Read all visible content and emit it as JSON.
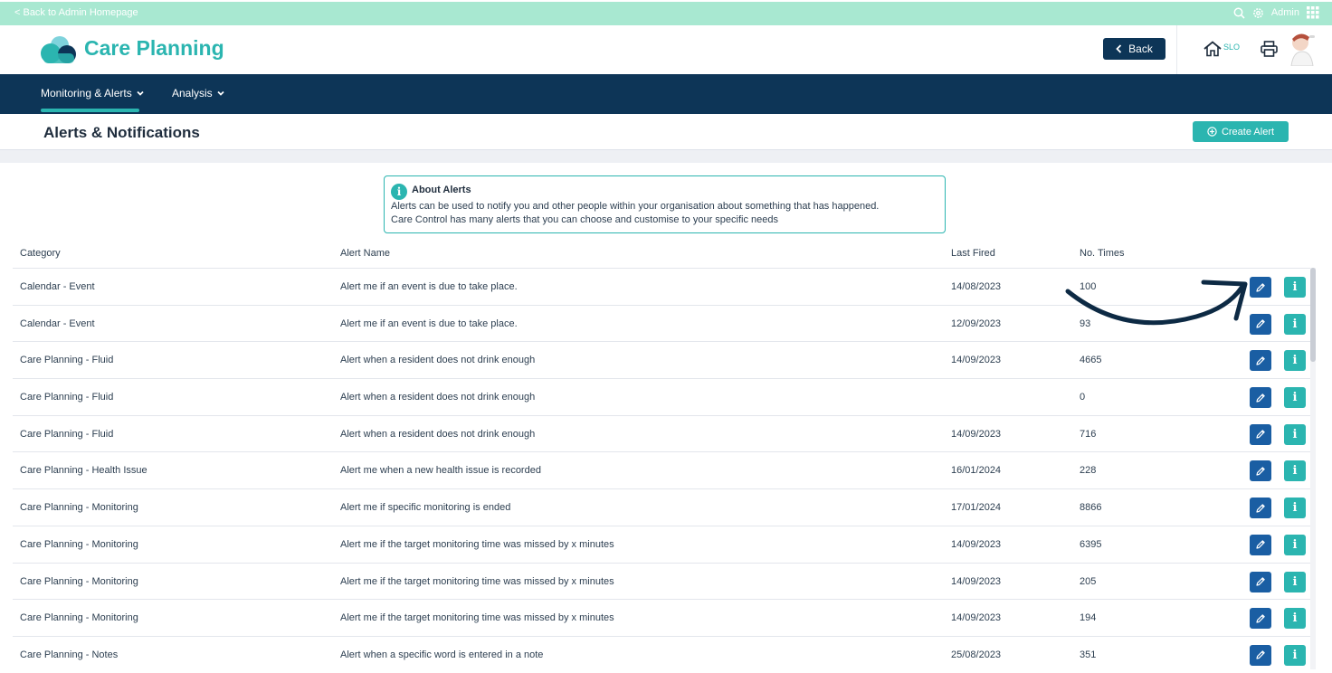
{
  "topbar": {
    "back_link": "< Back to Admin Homepage",
    "admin_label": "Admin"
  },
  "header": {
    "app_title": "Care Planning",
    "back_button": "Back",
    "home_label": "SLO"
  },
  "nav": {
    "items": [
      {
        "label": "Monitoring & Alerts"
      },
      {
        "label": "Analysis"
      }
    ]
  },
  "page": {
    "title": "Alerts & Notifications",
    "create_button": "Create Alert"
  },
  "info": {
    "icon": "i",
    "title": "About Alerts",
    "line1": "Alerts can be used to notify you and other people within your organisation about something that has happened.",
    "line2": "Care Control has many alerts that you can choose and customise to your specific needs"
  },
  "table": {
    "columns": {
      "category": "Category",
      "alert_name": "Alert Name",
      "last_fired": "Last Fired",
      "times": "No. Times"
    },
    "info_glyph": "i",
    "rows": [
      {
        "category": "Calendar - Event",
        "alert_name": "Alert me if an event is due to take place.",
        "last_fired": "14/08/2023",
        "times": "100"
      },
      {
        "category": "Calendar - Event",
        "alert_name": "Alert me if an event is due to take place.",
        "last_fired": "12/09/2023",
        "times": "93"
      },
      {
        "category": "Care Planning - Fluid",
        "alert_name": "Alert when a resident does not drink enough",
        "last_fired": "14/09/2023",
        "times": "4665"
      },
      {
        "category": "Care Planning - Fluid",
        "alert_name": "Alert when a resident does not drink enough",
        "last_fired": "",
        "times": "0"
      },
      {
        "category": "Care Planning - Fluid",
        "alert_name": "Alert when a resident does not drink enough",
        "last_fired": "14/09/2023",
        "times": "716"
      },
      {
        "category": "Care Planning - Health Issue",
        "alert_name": "Alert me when a new health issue is recorded",
        "last_fired": "16/01/2024",
        "times": "228"
      },
      {
        "category": "Care Planning - Monitoring",
        "alert_name": "Alert me if specific monitoring is ended",
        "last_fired": "17/01/2024",
        "times": "8866"
      },
      {
        "category": "Care Planning - Monitoring",
        "alert_name": "Alert me if the target monitoring time was missed by x minutes",
        "last_fired": "14/09/2023",
        "times": "6395"
      },
      {
        "category": "Care Planning - Monitoring",
        "alert_name": "Alert me if the target monitoring time was missed by x minutes",
        "last_fired": "14/09/2023",
        "times": "205"
      },
      {
        "category": "Care Planning - Monitoring",
        "alert_name": "Alert me if the target monitoring time was missed by x minutes",
        "last_fired": "14/09/2023",
        "times": "194"
      },
      {
        "category": "Care Planning - Notes",
        "alert_name": "Alert when a specific word is entered in a note",
        "last_fired": "25/08/2023",
        "times": "351"
      }
    ]
  },
  "colors": {
    "teal": "#2bb5b0",
    "navy": "#0d3557",
    "edit_blue": "#1a5ea3",
    "topbar_mint": "#a8e8d1"
  },
  "icons": [
    "search-icon",
    "gear-icon",
    "grid-icon",
    "home-icon",
    "print-icon",
    "pencil-icon",
    "info-icon",
    "chevron-down-icon",
    "plus-circle-icon"
  ]
}
